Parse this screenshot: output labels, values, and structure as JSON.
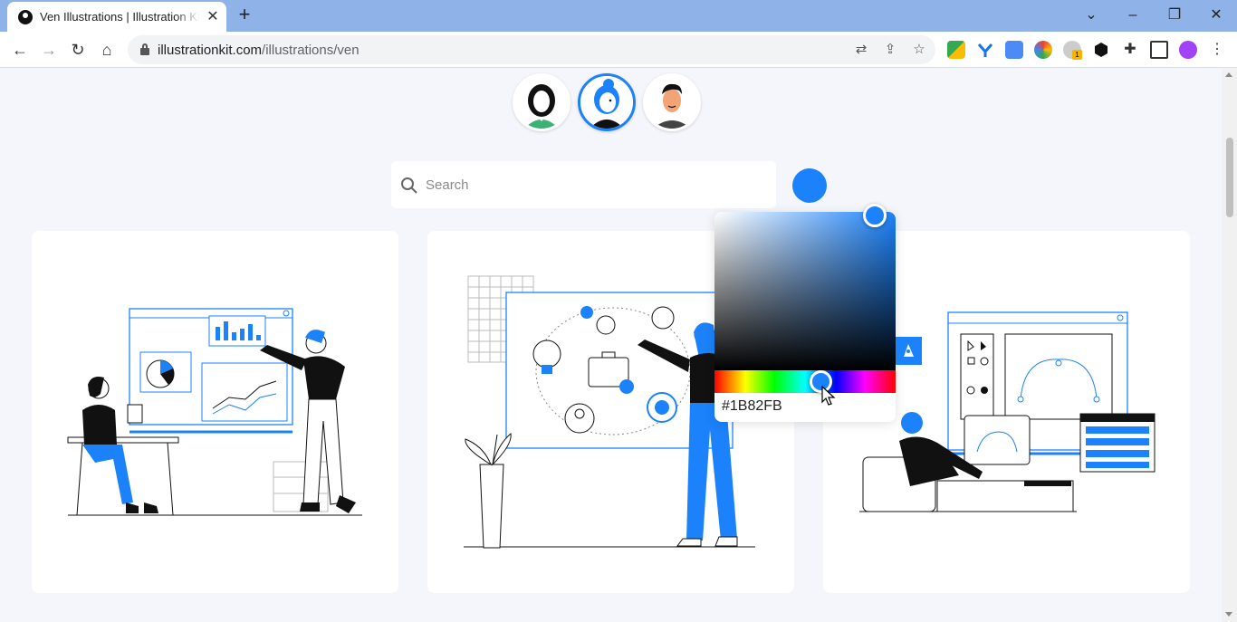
{
  "browser": {
    "tab_title": "Ven Illustrations | Illustration Kit",
    "url_host": "illustrationkit.com",
    "url_path": "/illustrations/ven"
  },
  "page": {
    "search_placeholder": "Search",
    "selected_color": "#1B82FB",
    "accent_color": "#1B82FB",
    "avatars": [
      {
        "name": "avatar-woman-green"
      },
      {
        "name": "avatar-woman-blue-bun",
        "selected": true
      },
      {
        "name": "avatar-man-dark"
      }
    ]
  },
  "color_picker": {
    "hex_label": "#1B82FB"
  },
  "icons": [
    "back-icon",
    "forward-icon",
    "reload-icon",
    "home-icon",
    "lock-icon",
    "translate-icon",
    "share-icon",
    "star-icon",
    "extensions-icon",
    "sidepanel-icon",
    "menu-icon",
    "search-icon"
  ]
}
